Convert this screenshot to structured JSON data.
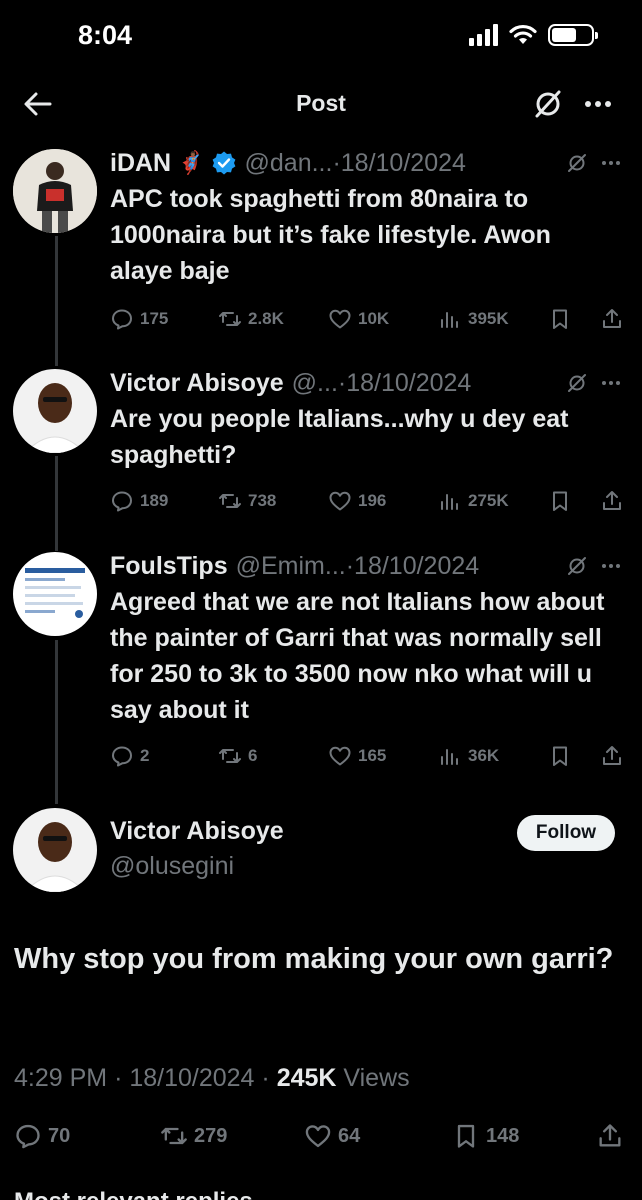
{
  "status_bar": {
    "time": "8:04"
  },
  "header": {
    "title": "Post"
  },
  "thread": [
    {
      "name": "iDAN",
      "emoji": "🦸🏾‍♂️",
      "verified": true,
      "handle": "@dan...",
      "date": "·18/10/2024",
      "text": "APC took spaghetti from 80naira to 1000naira but it’s fake lifestyle. Awon alaye baje",
      "replies": "175",
      "reposts": "2.8K",
      "likes": "10K",
      "views": "395K"
    },
    {
      "name": "Victor Abisoye",
      "handle": "@...",
      "date": "·18/10/2024",
      "text": "Are you people Italians...why u dey eat spaghetti?",
      "replies": "189",
      "reposts": "738",
      "likes": "196",
      "views": "275K"
    },
    {
      "name": "FoulsTips",
      "handle": "@Emim...",
      "date": "·18/10/2024",
      "text": "Agreed that we are not Italians how about the painter of Garri that was normally sell for 250 to 3k to 3500 now nko what will u say about it",
      "replies": "2",
      "reposts": "6",
      "likes": "165",
      "views": "36K"
    }
  ],
  "main": {
    "name": "Victor Abisoye",
    "handle": "@olusegini",
    "follow_label": "Follow",
    "text": "Why stop you from making your own garri?",
    "time": "4:29 PM",
    "date": "· 18/10/2024 ·",
    "views_count": "245K",
    "views_label": "Views",
    "replies": "70",
    "reposts": "279",
    "likes": "64",
    "bookmarks": "148"
  },
  "footer_cut_text": "Most relevant replies",
  "colors": {
    "background": "#000000",
    "text": "#e7e9ea",
    "muted": "#71767b",
    "verified": "#1d9bf0"
  }
}
